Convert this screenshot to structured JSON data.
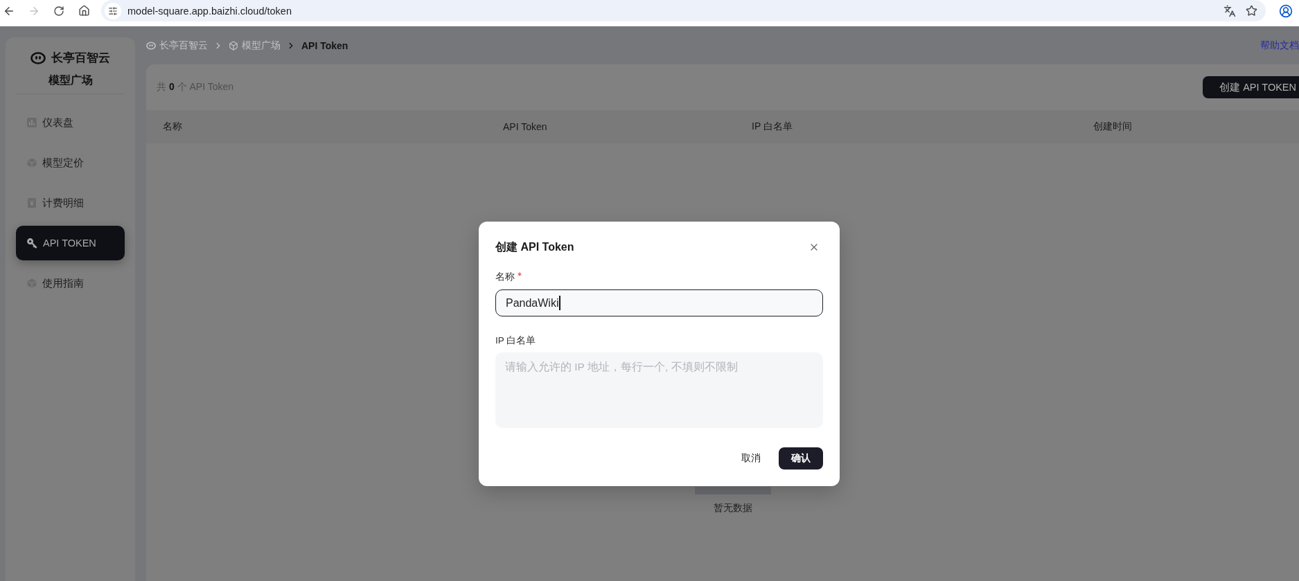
{
  "browser": {
    "forward_disabled": true,
    "url": "model-square.app.baizhi.cloud/token"
  },
  "sidebar": {
    "brand": "长亭百智云",
    "subtitle": "模型广场",
    "items": [
      {
        "label": "仪表盘",
        "selected": false
      },
      {
        "label": "模型定价",
        "selected": false
      },
      {
        "label": "计费明细",
        "selected": false
      },
      {
        "label": "API TOKEN",
        "selected": true
      },
      {
        "label": "使用指南",
        "selected": false
      }
    ]
  },
  "breadcrumb": [
    {
      "label": "长亭百智云"
    },
    {
      "label": "模型广场"
    },
    {
      "label": "API Token"
    }
  ],
  "help_link": "帮助文档",
  "token_list": {
    "count_text": "共 **0** 个 API Token",
    "create_button": "创建 API TOKEN",
    "columns": [
      "名称",
      "API Token",
      "IP 白名单",
      "创建时间"
    ],
    "empty_text": "暂无数据"
  },
  "dialog": {
    "title": "创建 API Token",
    "fields": [
      {
        "kind": "input",
        "label": "名称",
        "required": true,
        "focused": true,
        "value": "PandaWiki"
      },
      {
        "kind": "textarea",
        "label": "IP 白名单",
        "required": false,
        "placeholder": "请输入允许的 IP 地址，每行一个, 不填则不限制"
      }
    ],
    "buttons": [
      {
        "kind": "text",
        "label": "取消"
      },
      {
        "kind": "primary",
        "label": "确认"
      }
    ]
  }
}
